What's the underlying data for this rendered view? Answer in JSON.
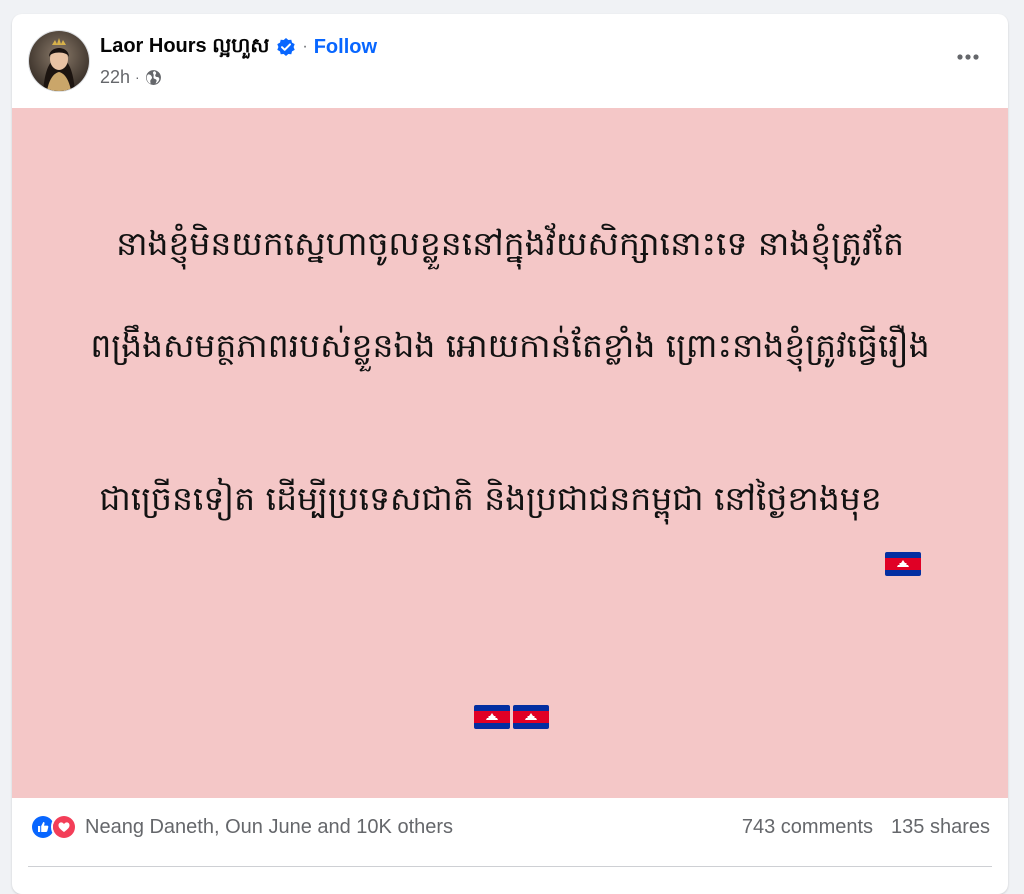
{
  "post": {
    "author": "Laor Hours ល្អហួស",
    "follow_label": "Follow",
    "time": "22h",
    "privacy_icon": "globe-icon",
    "verified_icon": "verified-badge-icon",
    "more_icon": "more-options-icon",
    "text_lines": [
      "នាងខ្ញុំមិនយកស្នេហាចូលខ្លួននៅក្នុងវ័យសិក្សានោះទេ នាងខ្ញុំត្រូវតែ",
      "ពង្រឹងសមត្ថភាពរបស់ខ្លួនឯង អោយកាន់តែខ្លាំង ព្រោះនាងខ្ញុំត្រូវធ្វើរឿង",
      "ជាច្រើនទៀត ដើម្បីប្រទេសជាតិ និងប្រជាជនកម្ពុជា នៅថ្ងៃខាងមុខ"
    ],
    "flag_icon": "cambodia-flag-icon",
    "background_color": "#f4c7c7"
  },
  "footer": {
    "reaction_icons": [
      "like-icon",
      "love-icon"
    ],
    "reaction_summary": "Neang Daneth, Oun June and 10K others",
    "comments": "743 comments",
    "shares": "135 shares"
  },
  "colors": {
    "accent": "#0866ff",
    "secondary_text": "#65676b",
    "love": "#f33e58"
  }
}
